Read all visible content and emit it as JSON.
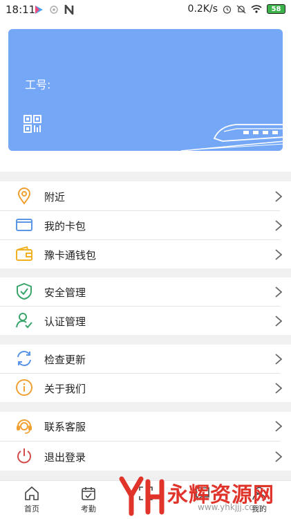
{
  "status_bar": {
    "time": "18:11",
    "speed": "0.2K/s",
    "battery": "58"
  },
  "card": {
    "employee_id_label": "工号:"
  },
  "menu": {
    "group1": [
      {
        "label": "附近",
        "icon": "location-pin-icon"
      },
      {
        "label": "我的卡包",
        "icon": "card-icon"
      },
      {
        "label": "豫卡通钱包",
        "icon": "wallet-icon"
      }
    ],
    "group2": [
      {
        "label": "安全管理",
        "icon": "shield-check-icon"
      },
      {
        "label": "认证管理",
        "icon": "user-check-icon"
      }
    ],
    "group3": [
      {
        "label": "检查更新",
        "icon": "refresh-icon"
      },
      {
        "label": "关于我们",
        "icon": "info-icon"
      }
    ],
    "group4": [
      {
        "label": "联系客服",
        "icon": "headset-icon"
      },
      {
        "label": "退出登录",
        "icon": "power-icon"
      }
    ]
  },
  "bottom_nav": [
    {
      "label": "首页",
      "icon": "home-icon"
    },
    {
      "label": "考勤",
      "icon": "calendar-check-icon"
    },
    {
      "label": "",
      "icon": "scan-icon"
    },
    {
      "label": "",
      "icon": "message-icon"
    },
    {
      "label": "我的",
      "icon": "profile-icon"
    }
  ],
  "watermark": {
    "brand": "永辉资源网",
    "url": "www.yhkjjj.com"
  },
  "colors": {
    "card_bg": "#74a7f6",
    "accent_orange": "#f0a030",
    "accent_green": "#3aa56a",
    "accent_blue": "#5a95e6",
    "accent_red": "#d24b4b"
  }
}
